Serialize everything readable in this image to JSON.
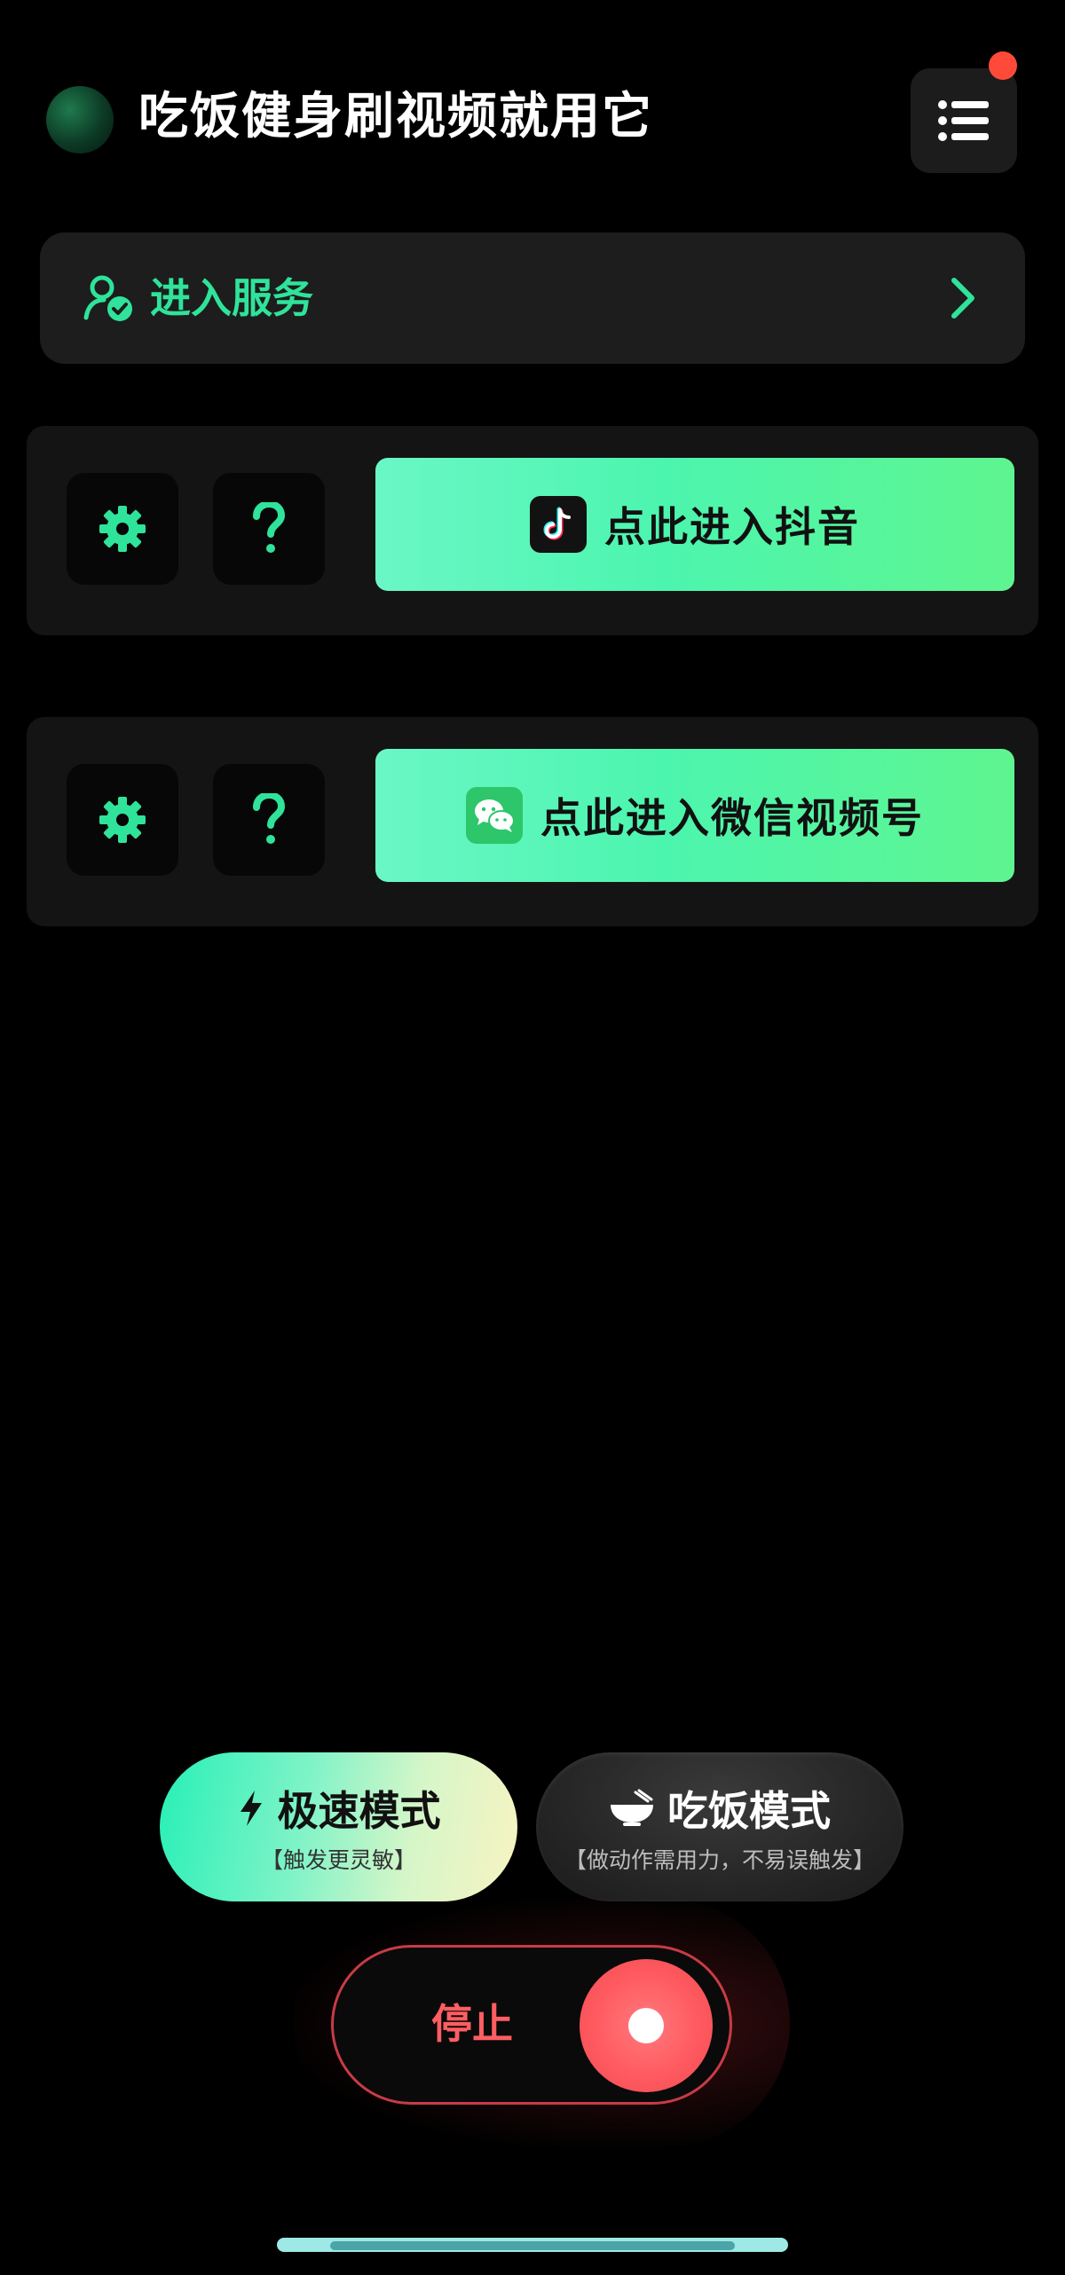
{
  "header": {
    "title": "吃饭健身刷视频就用它",
    "menu_icon": "list-icon",
    "notification_color": "#ff4a3a"
  },
  "service": {
    "label": "进入服务",
    "icon": "user-check-icon",
    "accent": "#2fe39a"
  },
  "platforms": [
    {
      "id": "douyin",
      "button_label": "点此进入抖音",
      "icon": "tiktok-icon"
    },
    {
      "id": "wechat",
      "button_label": "点此进入微信视频号",
      "icon": "wechat-icon"
    }
  ],
  "modes": {
    "fast": {
      "title": "极速模式",
      "subtitle": "【触发更灵敏】",
      "icon": "lightning-icon"
    },
    "eat": {
      "title": "吃饭模式",
      "subtitle": "【做动作需用力，不易误触发】",
      "icon": "bowl-icon"
    }
  },
  "stop": {
    "label": "停止",
    "color": "#ff5e62"
  }
}
